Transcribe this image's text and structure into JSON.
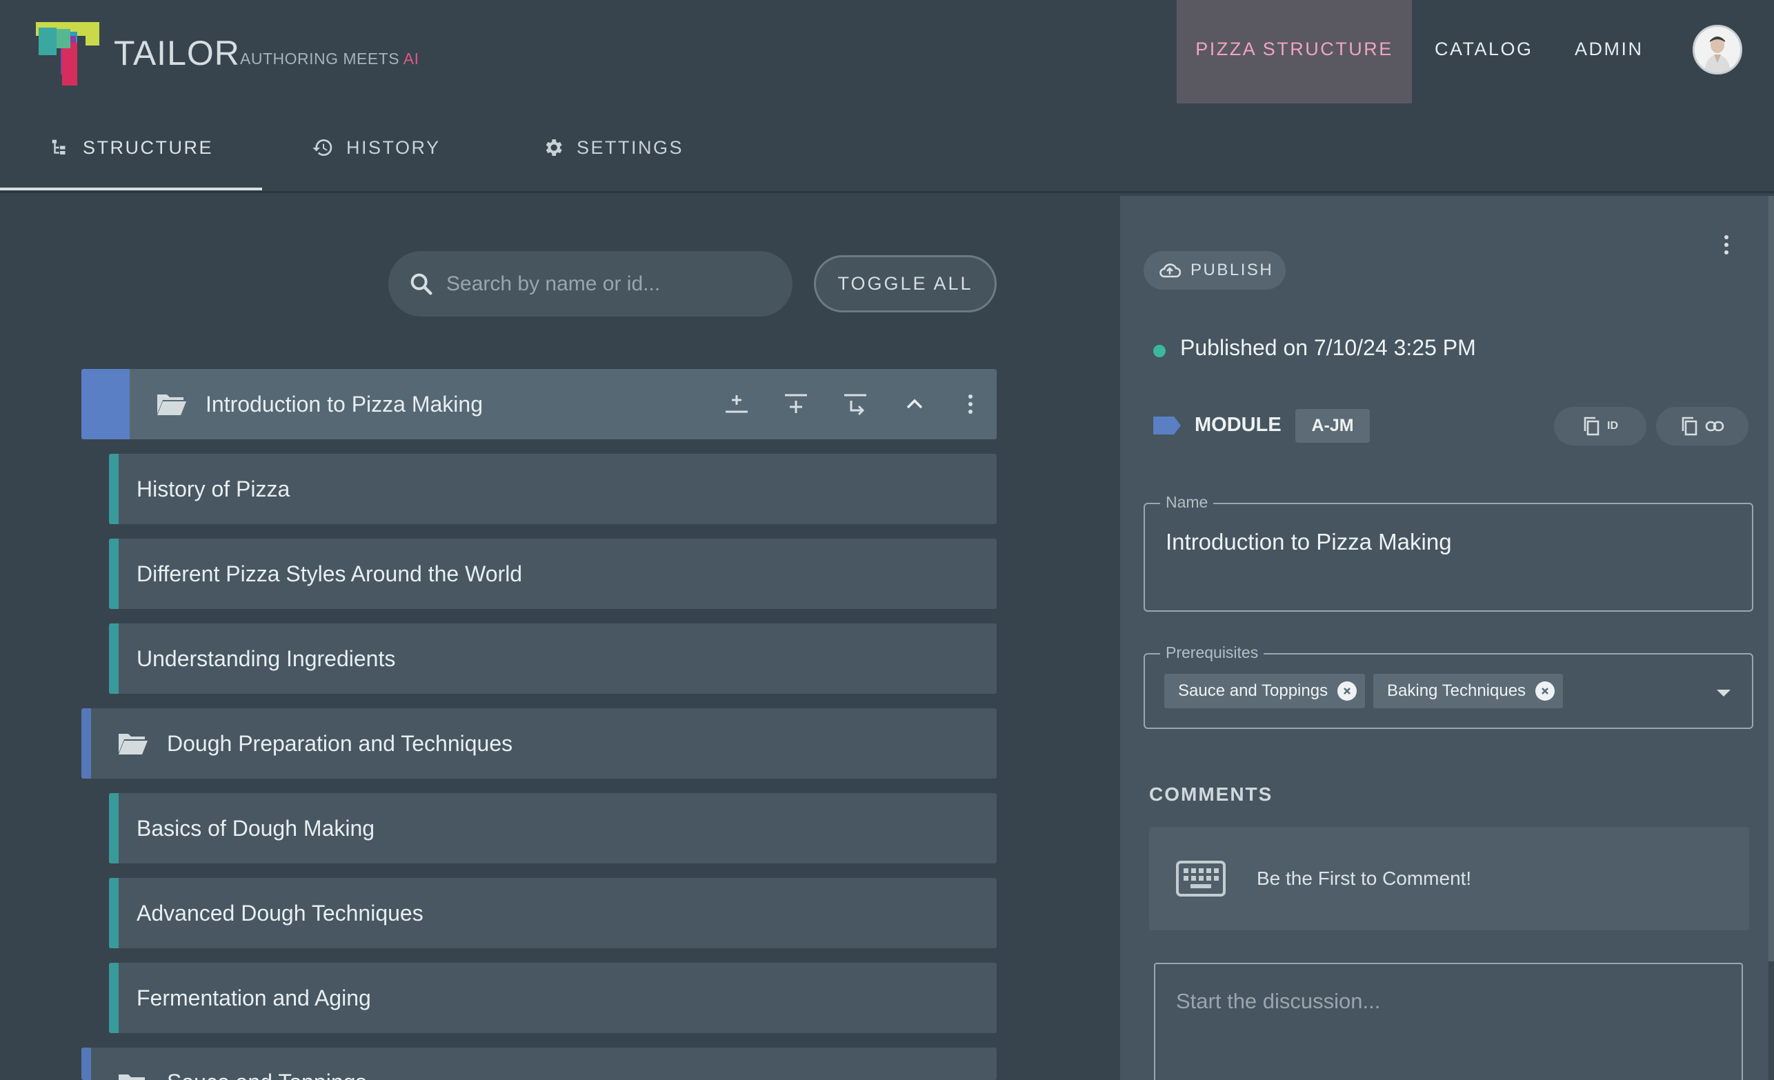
{
  "brand": {
    "name": "TAILOR",
    "tagline": "AUTHORING MEETS ",
    "tagline_ai": "AI"
  },
  "nav": {
    "items": [
      "PIZZA STRUCTURE",
      "CATALOG",
      "ADMIN"
    ]
  },
  "tabs": [
    "STRUCTURE",
    "HISTORY",
    "SETTINGS"
  ],
  "search": {
    "placeholder": "Search by name or id..."
  },
  "toggle_all": "TOGGLE ALL",
  "tree": [
    {
      "type": "group",
      "label": "Introduction to Pizza Making",
      "selected": true
    },
    {
      "type": "leaf",
      "label": "History of Pizza"
    },
    {
      "type": "leaf",
      "label": "Different Pizza Styles Around the World"
    },
    {
      "type": "leaf",
      "label": "Understanding Ingredients"
    },
    {
      "type": "group",
      "label": "Dough Preparation and Techniques"
    },
    {
      "type": "leaf",
      "label": "Basics of Dough Making"
    },
    {
      "type": "leaf",
      "label": "Advanced Dough Techniques"
    },
    {
      "type": "leaf",
      "label": "Fermentation and Aging"
    },
    {
      "type": "group",
      "label": "Sauce and Toppings"
    }
  ],
  "detail": {
    "publish_label": "PUBLISH",
    "published_text": "Published on 7/10/24 3:25 PM",
    "type_label": "MODULE",
    "id_badge": "A-JM",
    "copy_id_label": "ID",
    "name_legend": "Name",
    "name_value": "Introduction to Pizza Making",
    "prereq_legend": "Prerequisites",
    "prereqs": [
      "Sauce and Toppings",
      "Baking Techniques"
    ],
    "comments_heading": "COMMENTS",
    "empty_comments": "Be the First to Comment!",
    "discussion_placeholder": "Start the discussion..."
  },
  "colors": {
    "background": "#37444e",
    "active_nav_text": "#f0a5bd",
    "leaf_accent": "#3a9a9a",
    "group_accent": "#5578b8",
    "published_dot": "#3bb89a",
    "ai_accent": "#e0597f"
  }
}
